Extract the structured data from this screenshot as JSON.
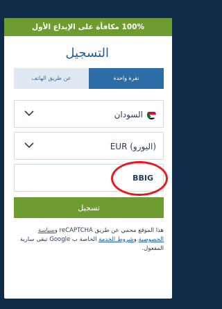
{
  "promo_banner": {
    "text": "100% مكافأة على الإيداع الأول"
  },
  "title": "التسجيل",
  "tabs": [
    {
      "label": "عن طريق الهاتف",
      "active": false
    },
    {
      "label": "نقرة واحدة",
      "active": true
    }
  ],
  "country": {
    "name": "السودان",
    "flag": "sudan-flag-icon"
  },
  "currency": {
    "value": "EUR (اليورو)"
  },
  "promo_code": {
    "value": "BBIG"
  },
  "register_button": {
    "label": "تسجيل"
  },
  "legal": {
    "part1": "هذا الموقع محمي عن طريق reCAPTCHA و",
    "privacy_link": "سياسة الخصوصية",
    "part2": " و",
    "terms_link": "شروط الخدمة",
    "part3": " الخاصة ب Google تبقى سارية المفعول."
  },
  "colors": {
    "page_background": "#0f2b47",
    "brand_green": "#6f9b33",
    "brand_blue": "#2d6ea8",
    "highlight_red": "#e51b20"
  }
}
